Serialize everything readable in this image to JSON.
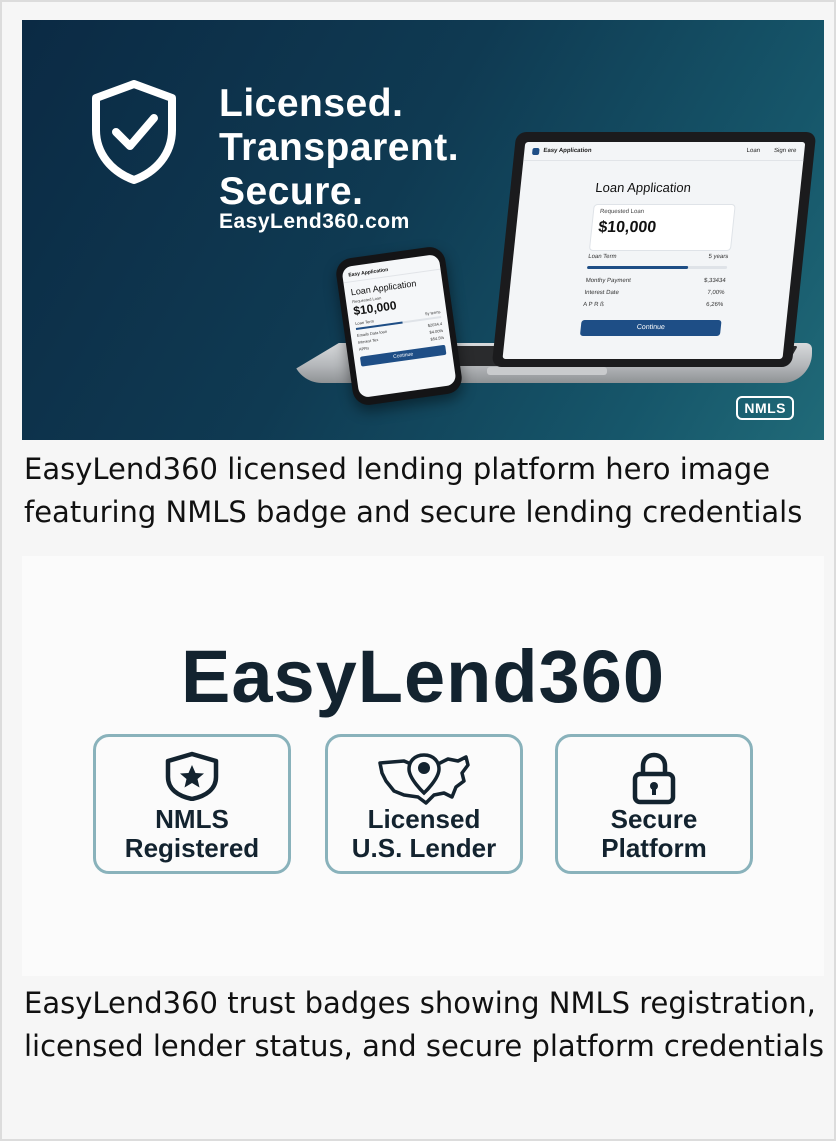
{
  "hero": {
    "headline": [
      "Licensed.",
      "Transparent.",
      "Secure."
    ],
    "site": "EasyLend360.com",
    "badge": "NMLS",
    "laptop": {
      "brand": "Easy Application",
      "nav": [
        "Loan",
        "Sign ere"
      ],
      "title": "Loan Application",
      "requested_label": "Requested Loan",
      "amount": "$10,000",
      "term_label": "Loan Term",
      "term_value": "5 years",
      "slider_fraction": 0.72,
      "rows": [
        {
          "label": "Monthy Payment",
          "value": "$,33434"
        },
        {
          "label": "Interest Date",
          "value": "7,00%"
        },
        {
          "label": "A P R ß",
          "value": "6,26%"
        }
      ],
      "button": "Continue"
    },
    "phone": {
      "brand": "Easy Application",
      "title": "Loan Application",
      "requested_label": "Requested Loan",
      "amount": "$10,000",
      "term_label": "Loan Term",
      "term_value": "5y terms",
      "slider_fraction": 0.55,
      "rows": [
        {
          "label": "Emails Data loan",
          "value": "$2034.4"
        },
        {
          "label": "Interest Tex",
          "value": "$4.00%"
        },
        {
          "label": "APRs",
          "value": "$54.5%"
        }
      ],
      "button": "Continue"
    },
    "caption": "EasyLend360 licensed lending platform hero image featuring NMLS badge and secure lending credentials"
  },
  "badges_image": {
    "brand": "EasyLend360",
    "badges": [
      {
        "line1": "NMLS",
        "line2": "Registered",
        "icon": "shield-star-icon"
      },
      {
        "line1": "Licensed",
        "line2": "U.S. Lender",
        "icon": "us-map-pin-icon"
      },
      {
        "line1": "Secure",
        "line2": "Platform",
        "icon": "padlock-icon"
      }
    ],
    "caption": "EasyLend360 trust badges showing NMLS registration, licensed lender status, and secure platform credentials"
  },
  "colors": {
    "hero_dark": "#0b2a44",
    "hero_teal": "#206a78",
    "accent_blue": "#1e4e86",
    "badge_border": "#89b2bb",
    "brand_text": "#13232f"
  }
}
